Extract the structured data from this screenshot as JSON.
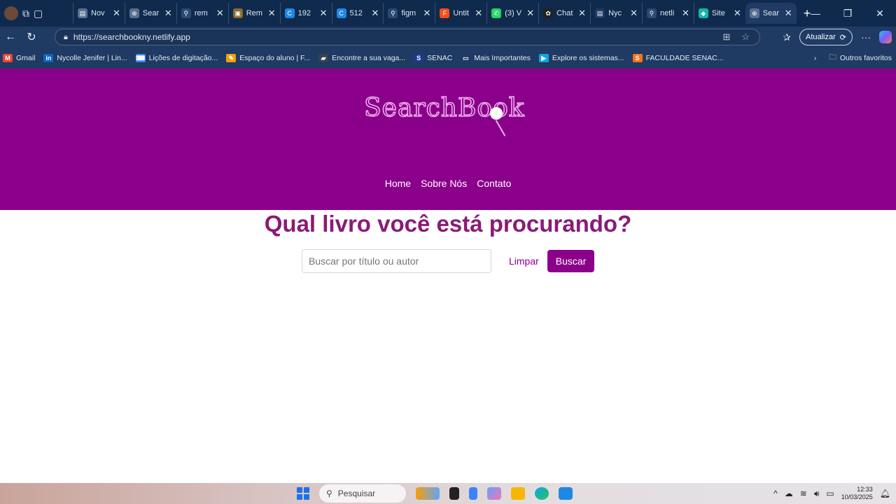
{
  "browser": {
    "tabs": [
      {
        "title": "Nov",
        "icon": "page-icon",
        "color": "#5a6f8f"
      },
      {
        "title": "Sear",
        "icon": "globe-icon",
        "color": "#5a6f8f"
      },
      {
        "title": "rem",
        "icon": "search-icon",
        "color": "#2b4a73"
      },
      {
        "title": "Rem",
        "icon": "book-icon",
        "color": "#8a6a2a"
      },
      {
        "title": "192",
        "icon": "c-icon",
        "color": "#1e88e5"
      },
      {
        "title": "512",
        "icon": "c-icon",
        "color": "#1e88e5"
      },
      {
        "title": "figm",
        "icon": "search-icon",
        "color": "#2b4a73"
      },
      {
        "title": "Untit",
        "icon": "figma-icon",
        "color": "#f24e1e"
      },
      {
        "title": "(3) V",
        "icon": "whatsapp-icon",
        "color": "#25d366"
      },
      {
        "title": "Chat",
        "icon": "chatgpt-icon",
        "color": "#222222"
      },
      {
        "title": "Nyc",
        "icon": "page-icon",
        "color": "#1f3a63"
      },
      {
        "title": "netli",
        "icon": "search-icon",
        "color": "#2b4a73"
      },
      {
        "title": "Site",
        "icon": "netlify-icon",
        "color": "#14b8a6"
      },
      {
        "title": "Sear",
        "icon": "globe-icon",
        "color": "#5a6f8f",
        "active": true
      }
    ],
    "url": "https://searchbookny.netlify.app",
    "update_label": "Atualizar",
    "bookmarks": [
      {
        "label": "Gmail",
        "icon": "gmail-icon",
        "color": "#ea4335"
      },
      {
        "label": "Nycolle Jenifer | Lin...",
        "icon": "linkedin-icon",
        "color": "#0a66c2"
      },
      {
        "label": "Lições de digitação...",
        "icon": "keyboard-icon",
        "color": "#3b82f6"
      },
      {
        "label": "Espaço do aluno | F...",
        "icon": "pen-icon",
        "color": "#f59e0b"
      },
      {
        "label": "Encontre a sua vaga...",
        "icon": "briefcase-icon",
        "color": "#374151"
      },
      {
        "label": "SENAC",
        "icon": "senac-icon",
        "color": "#1e3a8a"
      },
      {
        "label": "Mais Importantes",
        "icon": "folder-icon",
        "color": "#1f3a63"
      },
      {
        "label": "Explore os sistemas...",
        "icon": "play-icon",
        "color": "#0ea5e9"
      },
      {
        "label": "FACULDADE SENAC...",
        "icon": "senac-icon",
        "color": "#f97316"
      }
    ],
    "other_favorites": "Outros favoritos"
  },
  "site": {
    "logo_text": "SearchBook",
    "nav": [
      "Home",
      "Sobre Nós",
      "Contato"
    ],
    "hero_title": "Qual livro você está procurando?",
    "search_placeholder": "Buscar por título ou autor",
    "clear_label": "Limpar",
    "search_label": "Buscar",
    "brand_color": "#8b008b",
    "title_color": "#8b1a78"
  },
  "taskbar": {
    "search_label": "Pesquisar",
    "time": "12:33",
    "date": "10/03/2025"
  }
}
